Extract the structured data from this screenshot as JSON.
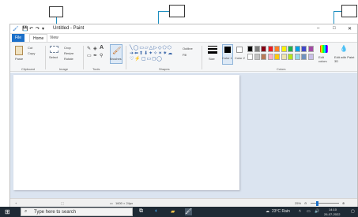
{
  "window": {
    "title": "Untitled - Paint",
    "controls": {
      "minimize": "–",
      "maximize": "□",
      "close": "✕"
    }
  },
  "quick_access": {
    "save_icon": "save-icon",
    "undo_icon": "undo-icon",
    "redo_icon": "redo-icon",
    "customize_icon": "dropdown-icon"
  },
  "tabs": [
    {
      "label": "File",
      "active": false
    },
    {
      "label": "Home",
      "active": true
    },
    {
      "label": "View",
      "active": false
    }
  ],
  "ribbon": {
    "clipboard": {
      "paste_label": "Paste",
      "cut_label": "Cut",
      "copy_label": "Copy",
      "group_label": "Clipboard"
    },
    "image": {
      "select_label": "Select",
      "crop_label": "Crop",
      "resize_label": "Resize",
      "rotate_label": "Rotate",
      "group_label": "Image"
    },
    "tools": {
      "group_label": "Tools"
    },
    "brushes": {
      "label": "Brushes"
    },
    "shapes": {
      "outline_label": "Outline",
      "fill_label": "Fill",
      "group_label": "Shapes"
    },
    "size": {
      "label": "Size"
    },
    "color1": {
      "label": "Color 1"
    },
    "color2": {
      "label": "Color 2"
    },
    "colors": {
      "group_label": "Colors",
      "edit_label": "Edit colors",
      "edit3d_label": "Edit with Paint 3D",
      "palette": [
        "#000000",
        "#7f7f7f",
        "#880015",
        "#ed1c24",
        "#ff7f27",
        "#fff200",
        "#22b14c",
        "#00a2e8",
        "#3f48cc",
        "#a349a4",
        "#ffffff",
        "#c3c3c3",
        "#b97a57",
        "#ffaec9",
        "#ffc90e",
        "#efe4b0",
        "#b5e61d",
        "#99d9ea",
        "#7092be",
        "#c8bfe7"
      ]
    }
  },
  "statusbar": {
    "dimensions": "1600 × 24px",
    "zoom": "25%"
  },
  "taskbar": {
    "search_placeholder": "Type here to search",
    "weather": "23°C  Rain",
    "time": "14:10",
    "date": "26-07-2022"
  },
  "colors": {
    "accent": "#1a6fc9",
    "pointer": "#1d8fc0",
    "taskbar": "#1f2a35",
    "canvas_bg": "#dbe4f0"
  }
}
